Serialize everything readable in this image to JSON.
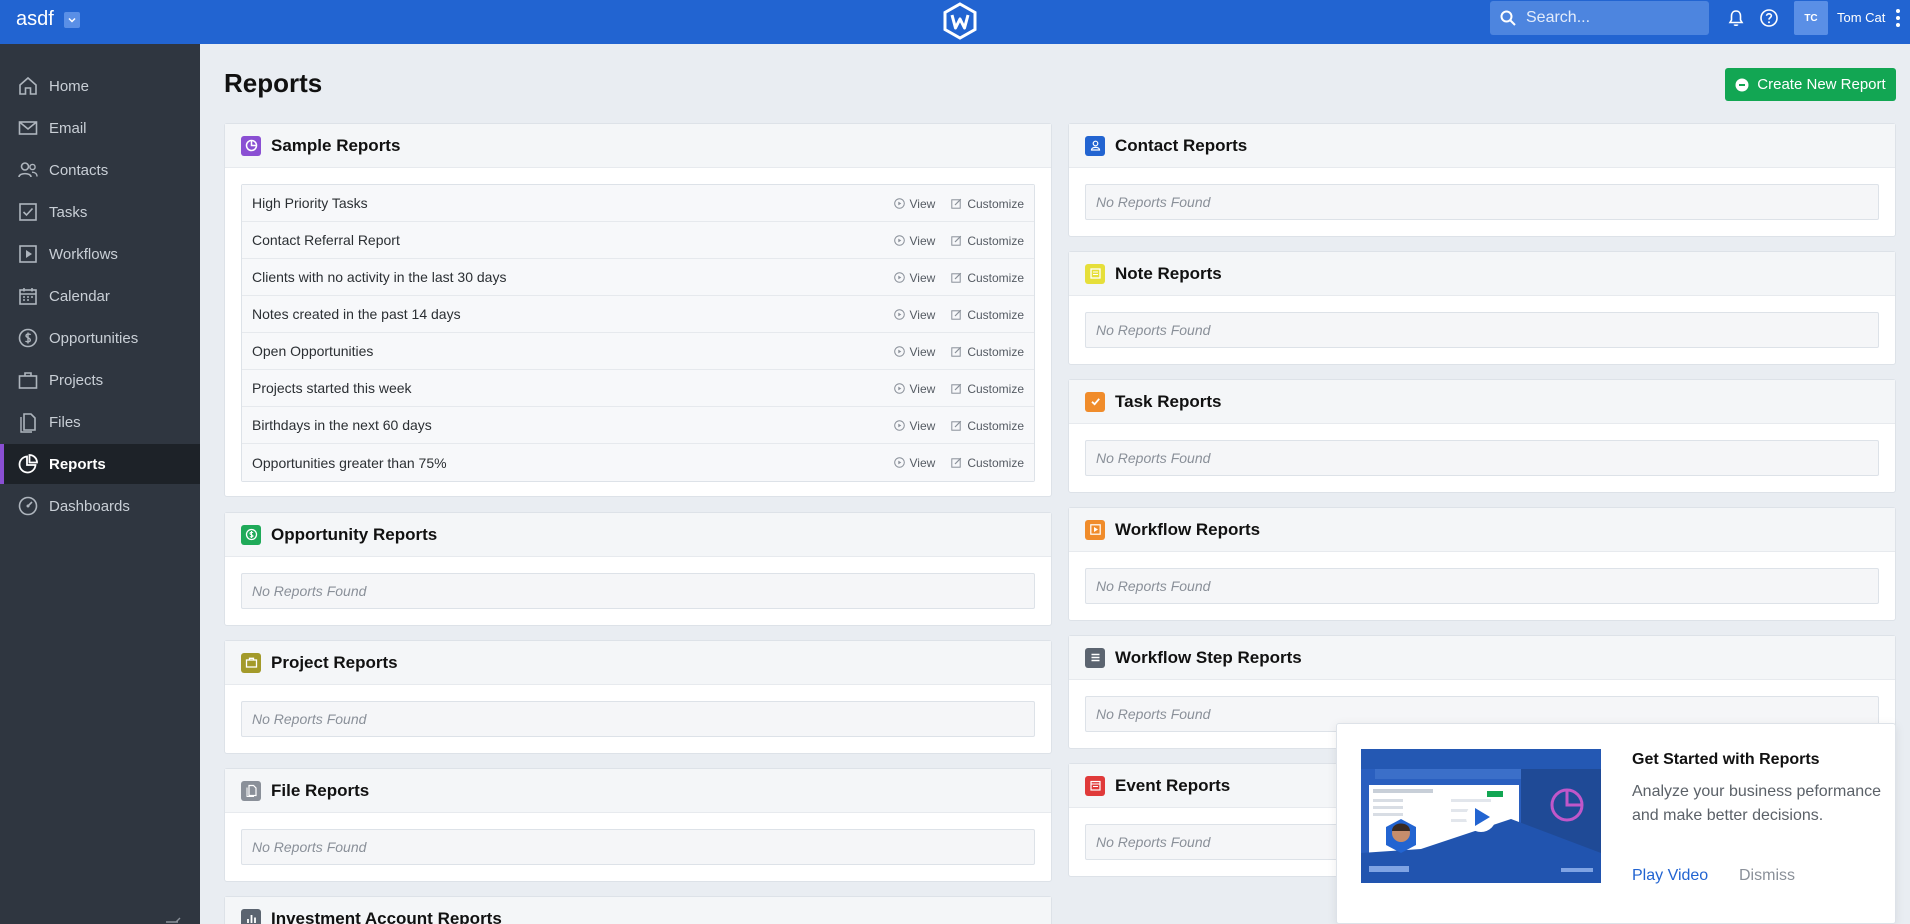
{
  "topbar": {
    "workspace": "asdf",
    "search_placeholder": "Search...",
    "user_initials": "TC",
    "user_name": "Tom Cat"
  },
  "sidebar": {
    "items": [
      {
        "label": "Home",
        "icon": "home-icon"
      },
      {
        "label": "Email",
        "icon": "email-icon"
      },
      {
        "label": "Contacts",
        "icon": "contacts-icon"
      },
      {
        "label": "Tasks",
        "icon": "tasks-icon"
      },
      {
        "label": "Workflows",
        "icon": "workflows-icon"
      },
      {
        "label": "Calendar",
        "icon": "calendar-icon"
      },
      {
        "label": "Opportunities",
        "icon": "opportunities-icon"
      },
      {
        "label": "Projects",
        "icon": "projects-icon"
      },
      {
        "label": "Files",
        "icon": "files-icon"
      },
      {
        "label": "Reports",
        "icon": "reports-icon",
        "active": true
      },
      {
        "label": "Dashboards",
        "icon": "dashboards-icon"
      }
    ]
  },
  "page": {
    "title": "Reports",
    "create_button": "Create New Report"
  },
  "sample_reports": {
    "title": "Sample Reports",
    "view_label": "View",
    "customize_label": "Customize",
    "rows": [
      "High Priority Tasks",
      "Contact Referral Report",
      "Clients with no activity in the last 30 days",
      "Notes created in the past 14 days",
      "Open Opportunities",
      "Projects started this week",
      "Birthdays in the next 60 days",
      "Opportunities greater than 75%"
    ]
  },
  "empty_label": "No Reports Found",
  "left_cards": [
    {
      "title": "Opportunity Reports",
      "color": "#1faa59"
    },
    {
      "title": "Project Reports",
      "color": "#a39a2a"
    },
    {
      "title": "File Reports",
      "color": "#8a9099"
    },
    {
      "title": "Investment Account Reports",
      "color": "#5b6470"
    }
  ],
  "right_cards": [
    {
      "title": "Contact Reports",
      "color": "#2264d1"
    },
    {
      "title": "Note Reports",
      "color": "#e6df3a"
    },
    {
      "title": "Task Reports",
      "color": "#f08c2b"
    },
    {
      "title": "Workflow Reports",
      "color": "#f08c2b"
    },
    {
      "title": "Workflow Step Reports",
      "color": "#5b6470"
    },
    {
      "title": "Event Reports",
      "color": "#e03a3a"
    }
  ],
  "promo": {
    "title": "Get Started with Reports",
    "text": "Analyze your business peformance and make better decisions.",
    "play": "Play Video",
    "dismiss": "Dismiss"
  },
  "colors": {
    "topbar": "#2264d1",
    "sidebar": "#2f3640",
    "accent_green": "#12a653",
    "sample_reports_icon": "#8a4fd3"
  }
}
